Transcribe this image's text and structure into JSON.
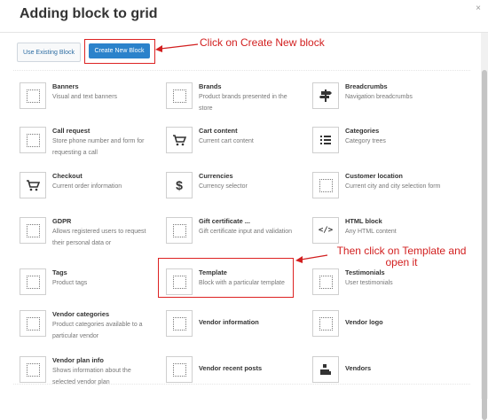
{
  "dialog": {
    "title": "Adding block to grid",
    "close_glyph": "×"
  },
  "toolbar": {
    "use_existing_label": "Use Existing Block",
    "create_new_label": "Create New Block"
  },
  "annotations": {
    "create_new": "Click on Create New block",
    "template_line1": "Then click on Template and",
    "template_line2": "open it",
    "color": "#d21f1f"
  },
  "colors": {
    "primary_button": "#2b82cb",
    "highlight_border": "#dd2222"
  },
  "blocks": [
    {
      "name": "Banners",
      "desc": "Visual and text banners",
      "icon": "placeholder-icon"
    },
    {
      "name": "Brands",
      "desc": "Product brands presented in the store",
      "icon": "placeholder-icon"
    },
    {
      "name": "Breadcrumbs",
      "desc": "Navigation breadcrumbs",
      "icon": "signpost-icon"
    },
    {
      "name": "Call request",
      "desc": "Store phone number and form for requesting a call",
      "icon": "placeholder-icon"
    },
    {
      "name": "Cart content",
      "desc": "Current cart content",
      "icon": "cart-icon"
    },
    {
      "name": "Categories",
      "desc": "Category trees",
      "icon": "list-icon"
    },
    {
      "name": "Checkout",
      "desc": "Current order information",
      "icon": "cart-icon"
    },
    {
      "name": "Currencies",
      "desc": "Currency selector",
      "icon": "dollar-icon"
    },
    {
      "name": "Customer location",
      "desc": "Current city and city selection form",
      "icon": "placeholder-icon"
    },
    {
      "name": "GDPR",
      "desc": "Allows registered users to request their personal data or",
      "icon": "placeholder-icon"
    },
    {
      "name": "Gift certificate ...",
      "desc": "Gift certificate input and validation",
      "icon": "placeholder-icon"
    },
    {
      "name": "HTML block",
      "desc": "Any HTML content",
      "icon": "code-icon"
    },
    {
      "name": "Tags",
      "desc": "Product tags",
      "icon": "placeholder-icon"
    },
    {
      "name": "Template",
      "desc": "Block with a particular template",
      "icon": "placeholder-icon"
    },
    {
      "name": "Testimonials",
      "desc": "User testimonials",
      "icon": "placeholder-icon"
    },
    {
      "name": "Vendor categories",
      "desc": "Product categories available to a particular vendor",
      "icon": "placeholder-icon"
    },
    {
      "name": "Vendor information",
      "desc": "",
      "icon": "placeholder-icon"
    },
    {
      "name": "Vendor logo",
      "desc": "",
      "icon": "placeholder-icon"
    },
    {
      "name": "Vendor plan info",
      "desc": "Shows information about the selected vendor plan",
      "icon": "placeholder-icon"
    },
    {
      "name": "Vendor recent posts",
      "desc": "",
      "icon": "placeholder-icon"
    },
    {
      "name": "Vendors",
      "desc": "",
      "icon": "vendor-icon"
    }
  ]
}
